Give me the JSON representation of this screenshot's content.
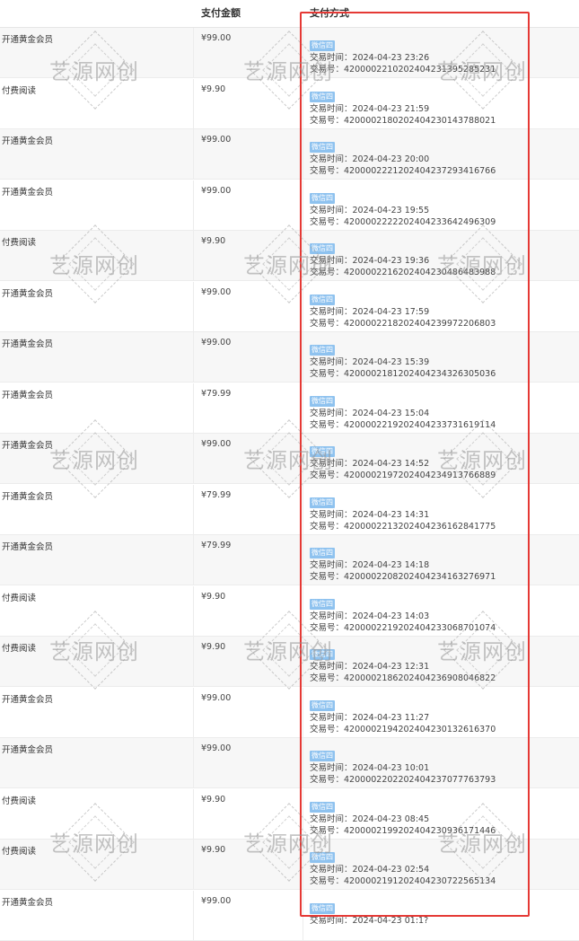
{
  "table": {
    "headers": {
      "amount": "支付金额",
      "method": "支付方式"
    },
    "time_prefix": "交易时间：",
    "txn_prefix": "交易号：",
    "rows": [
      {
        "type": "开通黄金会员",
        "amount": "¥99.00",
        "badge": "微信四",
        "time": "2024-04-23 23:26",
        "txn": "4200002210202404231395285231"
      },
      {
        "type": "付费阅读",
        "amount": "¥9.90",
        "badge": "微信四",
        "time": "2024-04-23 21:59",
        "txn": "4200002180202404230143788021"
      },
      {
        "type": "开通黄金会员",
        "amount": "¥99.00",
        "badge": "微信四",
        "time": "2024-04-23 20:00",
        "txn": "4200002221202404237293416766"
      },
      {
        "type": "开通黄金会员",
        "amount": "¥99.00",
        "badge": "微信四",
        "time": "2024-04-23 19:55",
        "txn": "4200002222202404233642496309"
      },
      {
        "type": "付费阅读",
        "amount": "¥9.90",
        "badge": "微信四",
        "time": "2024-04-23 19:36",
        "txn": "4200002216202404230486483988"
      },
      {
        "type": "开通黄金会员",
        "amount": "¥99.00",
        "badge": "微信四",
        "time": "2024-04-23 17:59",
        "txn": "4200002218202404239972206803"
      },
      {
        "type": "开通黄金会员",
        "amount": "¥99.00",
        "badge": "微信四",
        "time": "2024-04-23 15:39",
        "txn": "4200002181202404234326305036"
      },
      {
        "type": "开通黄金会员",
        "amount": "¥79.99",
        "badge": "微信四",
        "time": "2024-04-23 15:04",
        "txn": "4200002219202404233731619114"
      },
      {
        "type": "开通黄金会员",
        "amount": "¥99.00",
        "badge": "微信四",
        "time": "2024-04-23 14:52",
        "txn": "4200002197202404234913766889"
      },
      {
        "type": "开通黄金会员",
        "amount": "¥79.99",
        "badge": "微信四",
        "time": "2024-04-23 14:31",
        "txn": "4200002213202404236162841775"
      },
      {
        "type": "开通黄金会员",
        "amount": "¥79.99",
        "badge": "微信四",
        "time": "2024-04-23 14:18",
        "txn": "4200002208202404234163276971"
      },
      {
        "type": "付费阅读",
        "amount": "¥9.90",
        "badge": "微信四",
        "time": "2024-04-23 14:03",
        "txn": "4200002219202404233068701074"
      },
      {
        "type": "付费阅读",
        "amount": "¥9.90",
        "badge": "微信四",
        "time": "2024-04-23 12:31",
        "txn": "4200002186202404236908046822"
      },
      {
        "type": "开通黄金会员",
        "amount": "¥99.00",
        "badge": "微信四",
        "time": "2024-04-23 11:27",
        "txn": "4200002194202404230132616370"
      },
      {
        "type": "开通黄金会员",
        "amount": "¥99.00",
        "badge": "微信四",
        "time": "2024-04-23 10:01",
        "txn": "4200002202202404237077763793"
      },
      {
        "type": "付费阅读",
        "amount": "¥9.90",
        "badge": "微信四",
        "time": "2024-04-23 08:45",
        "txn": "4200002199202404230936171446"
      },
      {
        "type": "付费阅读",
        "amount": "¥9.90",
        "badge": "微信四",
        "time": "2024-04-23 02:54",
        "txn": "4200002191202404230722565134"
      },
      {
        "type": "开通黄金会员",
        "amount": "¥99.00",
        "badge": "微信四",
        "time": "2024-04-23 01:1?",
        "txn": ""
      }
    ]
  },
  "watermark": {
    "text": "艺源网创"
  },
  "colors": {
    "badge": "#8ec2ef",
    "highlight_box": "#e53935",
    "row_alt": "#f7f7f7"
  }
}
